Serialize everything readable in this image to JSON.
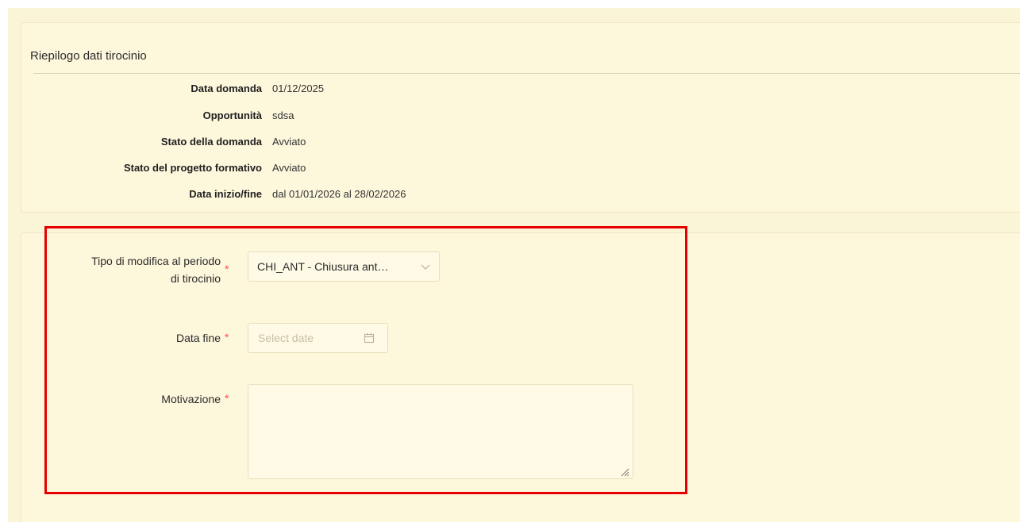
{
  "summary": {
    "title": "Riepilogo dati tirocinio",
    "rows": [
      {
        "label": "Data domanda",
        "value": "01/12/2025"
      },
      {
        "label": "Opportunità",
        "value": "sdsa"
      },
      {
        "label": "Stato della domanda",
        "value": "Avviato"
      },
      {
        "label": "Stato del progetto formativo",
        "value": "Avviato"
      },
      {
        "label": "Data inizio/fine",
        "value": "dal 01/01/2026 al 28/02/2026"
      }
    ]
  },
  "form": {
    "tipo_modifica": {
      "label_line1": "Tipo di modifica al periodo",
      "label_line2": "di tirocinio",
      "selected": "CHI_ANT - Chiusura ant…",
      "required_mark": "*"
    },
    "data_fine": {
      "label": "Data fine",
      "placeholder": "Select date",
      "required_mark": "*"
    },
    "motivazione": {
      "label": "Motivazione",
      "value": "",
      "required_mark": "*"
    }
  },
  "colors": {
    "page_bg": "#fbf5d8",
    "highlight": "#e60000",
    "required": "#ff4d4f"
  }
}
